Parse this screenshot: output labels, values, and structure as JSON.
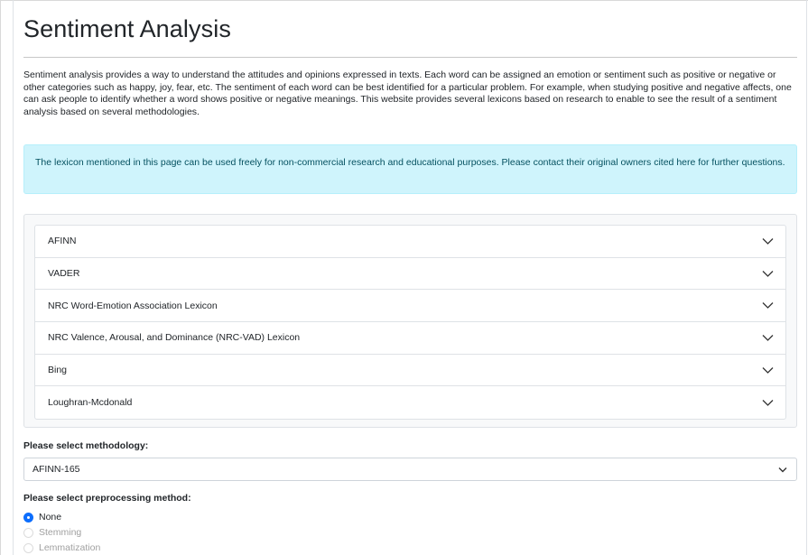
{
  "page": {
    "title": "Sentiment Analysis",
    "intro": "Sentiment analysis provides a way to understand the attitudes and opinions expressed in texts. Each word can be assigned an emotion or sentiment such as positive or negative or other categories such as happy, joy, fear, etc. The sentiment of each word can be best identified for a particular problem. For example, when studying positive and negative affects, one can ask people to identify whether a word shows positive or negative meanings. This website provides several lexicons based on research to enable to see the result of a sentiment analysis based on several methodologies."
  },
  "alert": {
    "text": "The lexicon mentioned in this page can be used freely for non-commercial research and educational purposes. Please contact their original owners cited here for further questions."
  },
  "accordion": {
    "items": [
      {
        "label": "AFINN"
      },
      {
        "label": "VADER"
      },
      {
        "label": "NRC Word-Emotion Association Lexicon"
      },
      {
        "label": "NRC Valence, Arousal, and Dominance (NRC-VAD) Lexicon"
      },
      {
        "label": "Bing"
      },
      {
        "label": "Loughran-Mcdonald"
      }
    ]
  },
  "methodology": {
    "label": "Please select methodology:",
    "selected": "AFINN-165"
  },
  "preprocessing": {
    "label": "Please select preprocessing method:",
    "options": [
      {
        "label": "None",
        "checked": true
      },
      {
        "label": "Stemming",
        "checked": false
      },
      {
        "label": "Lemmatization",
        "checked": false
      }
    ]
  },
  "colors": {
    "alert_bg": "#cff4fc",
    "alert_text": "#055160",
    "radio_accent": "#0d6efd"
  }
}
